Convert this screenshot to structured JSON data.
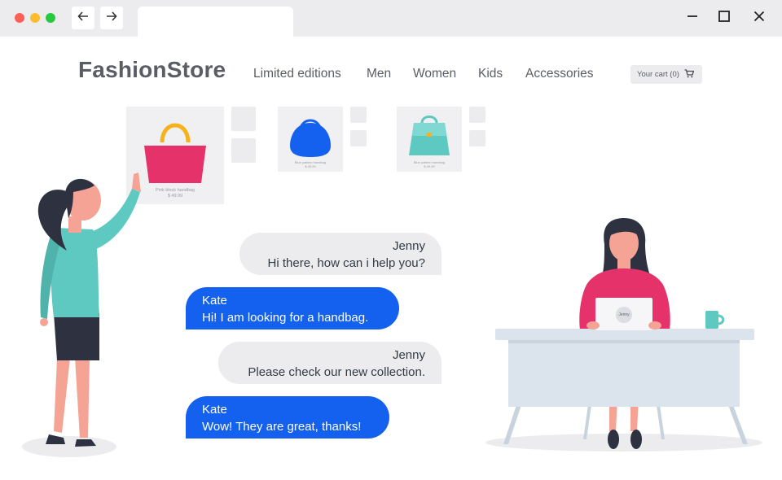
{
  "site": {
    "logo": "FashionStore",
    "nav": [
      "Limited editions",
      "Men",
      "Women",
      "Kids",
      "Accessories"
    ],
    "cart_label": "Your cart (0)"
  },
  "products": [
    {
      "name": "Pink block handbag",
      "price": "$ 49.99",
      "color": "#e5326b"
    },
    {
      "name": "Blue pattern handbag",
      "price": "$ 49.99",
      "color": "#1461f0"
    },
    {
      "name": "Blue pattern handbag",
      "price": "$ 49.99",
      "color": "#5ec9c1"
    }
  ],
  "chat": [
    {
      "sender": "Jenny",
      "text": "Hi there, how can i help you?"
    },
    {
      "sender": "Kate",
      "text": "Hi! I am looking for a handbag."
    },
    {
      "sender": "Jenny",
      "text": "Please check our new collection."
    },
    {
      "sender": "Kate",
      "text": "Wow! They are great, thanks!"
    }
  ],
  "laptop_label": "Jenny",
  "colors": {
    "accent_blue": "#1461f0",
    "pink": "#e5326b",
    "teal": "#5ec9c1",
    "chrome": "#ececef",
    "text": "#5b5d66"
  }
}
